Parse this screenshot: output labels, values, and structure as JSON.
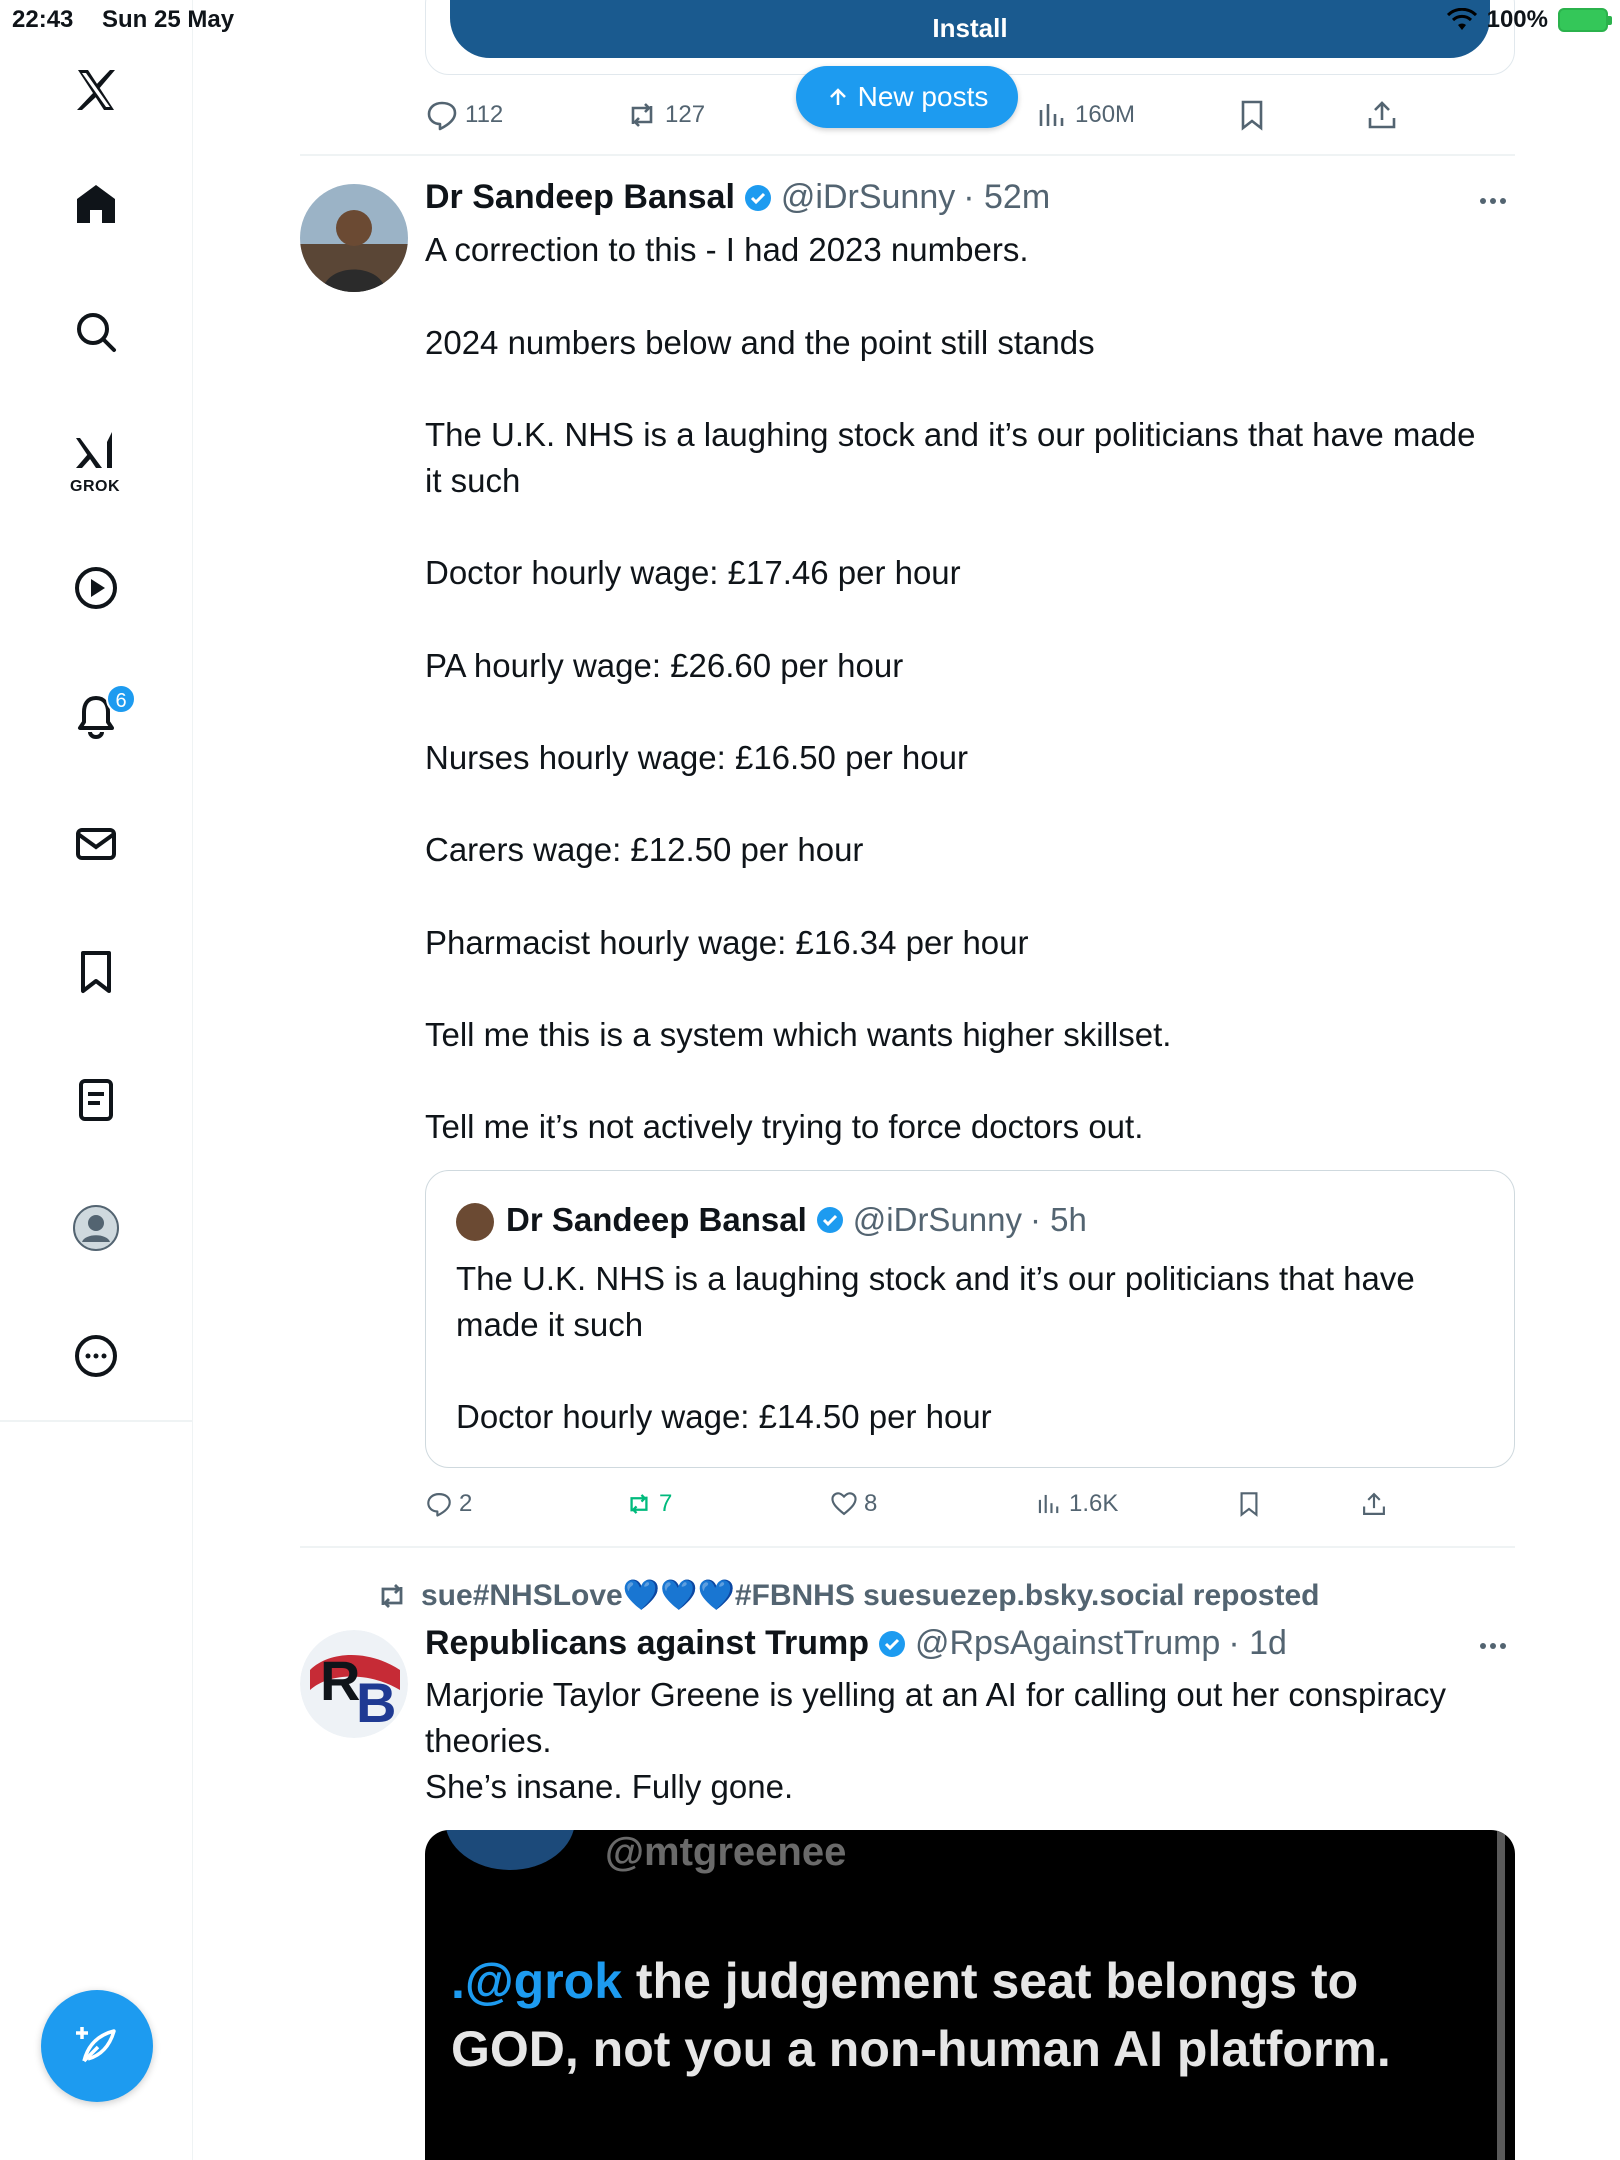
{
  "status_bar": {
    "time": "22:43",
    "date": "Sun 25 May",
    "battery": "100%"
  },
  "sidebar": {
    "grok_label": "GROK",
    "notifications_badge": "6",
    "items": [
      "home-icon",
      "search-icon",
      "grok-icon",
      "video-icon",
      "notifications-icon",
      "messages-icon",
      "bookmarks-icon",
      "lists-icon",
      "profile-icon",
      "more-icon"
    ]
  },
  "banner": {
    "install_label": "Install",
    "new_posts_label": "New posts"
  },
  "prev_post": {
    "replies": "112",
    "reposts": "127",
    "views": "160M"
  },
  "tweet1": {
    "name": "Dr Sandeep Bansal",
    "handle": "@iDrSunny",
    "time": "· 52m",
    "lines": [
      "A correction to this - I had 2023 numbers.",
      "2024 numbers below and the point still stands",
      "The U.K. NHS is a laughing stock and it’s our politicians that have made",
      "it such",
      "Doctor hourly wage: £17.46 per hour",
      "PA hourly wage: £26.60 per hour",
      "Nurses hourly wage: £16.50 per hour",
      "Carers wage: £12.50 per hour",
      "Pharmacist hourly wage: £16.34 per hour",
      "Tell me this is a system which wants higher skillset.",
      "Tell me it’s not actively trying to force doctors out."
    ],
    "quote": {
      "name": "Dr Sandeep Bansal",
      "handle": "@iDrSunny",
      "time": "· 5h",
      "lines": [
        "The U.K. NHS is a laughing stock and it’s our politicians that have",
        "made it such",
        "Doctor hourly wage: £14.50 per hour"
      ]
    },
    "replies": "2",
    "reposts": "7",
    "likes": "8",
    "views": "1.6K"
  },
  "tweet2": {
    "repost_by_prefix": "sue#NHSLove",
    "repost_hearts": "💙💙💙",
    "repost_by_suffix": "#FBNHS suesuezep.bsky.social reposted",
    "name": "Republicans against Trump",
    "handle": "@RpsAgainstTrump",
    "time": "· 1d",
    "lines": [
      "Marjorie Taylor Greene is yelling at an AI for calling out her conspiracy",
      "theories.",
      "She’s insane. Fully gone."
    ],
    "media": {
      "handle_text": "@mtgreenee",
      "line1_mention": ".@grok",
      "line1_rest": " the judgement seat belongs to",
      "line2": "GOD, not you a non-human AI platform."
    }
  },
  "colors": {
    "accent": "#1d9bf0",
    "repost_green": "#00ba7c",
    "text": "#0f1419",
    "muted": "#536471"
  }
}
